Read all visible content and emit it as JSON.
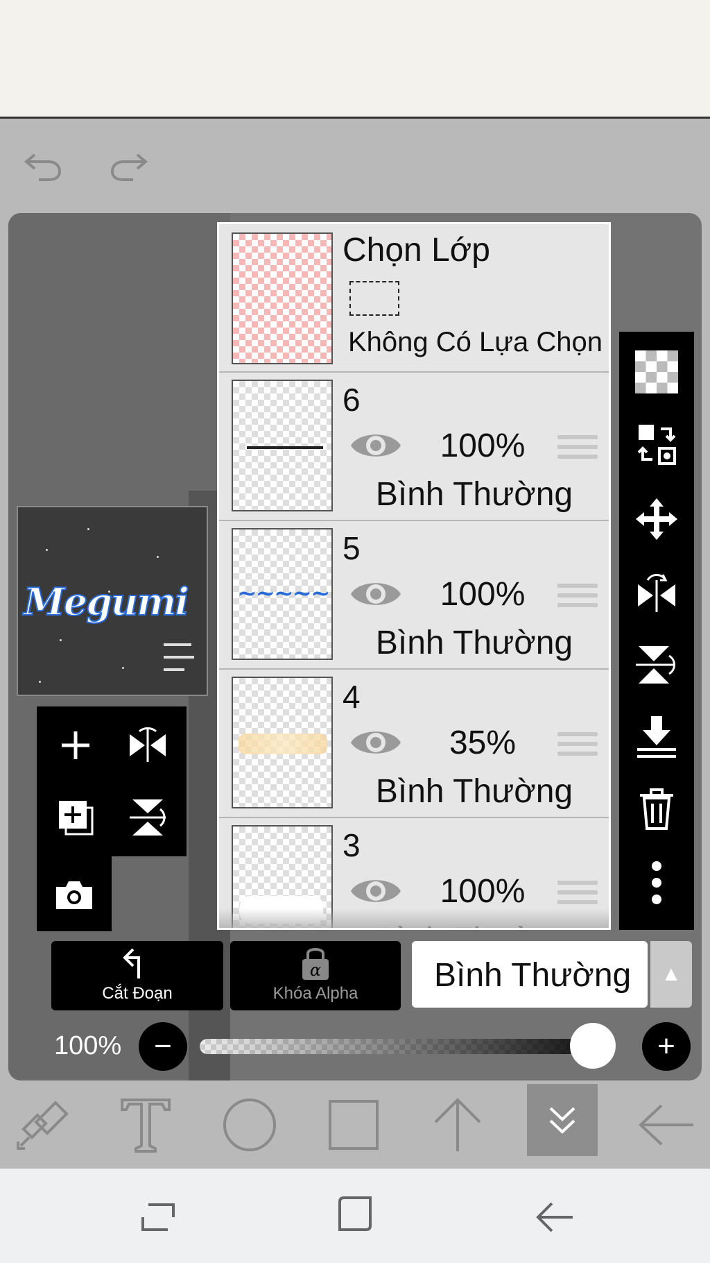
{
  "layer_panel": {
    "selection_layer": {
      "title": "Chọn Lớp",
      "subtitle": "Không Có Lựa Chọn"
    },
    "layers": [
      {
        "name": "6",
        "opacity": "100%",
        "blend": "Bình Thường"
      },
      {
        "name": "5",
        "opacity": "100%",
        "blend": "Bình Thường"
      },
      {
        "name": "4",
        "opacity": "35%",
        "blend": "Bình Thường"
      },
      {
        "name": "3",
        "opacity": "100%",
        "blend": "Bình Thường"
      }
    ]
  },
  "preview": {
    "title": "Megumi"
  },
  "controls": {
    "clipping_label": "Cắt Đoạn",
    "alpha_lock_label": "Khóa Alpha",
    "blend_mode": "Bình Thường",
    "opacity_label": "100%",
    "opacity_value": 1.0
  },
  "colors": {
    "accent": "#2a6bd8",
    "panel_bg": "#e6e6e6",
    "canvas_bg": "#737373"
  },
  "icons": {
    "toolbar": [
      "undo-icon",
      "redo-icon"
    ],
    "left_tools": [
      "add-layer-icon",
      "flip-horizontal-icon",
      "copy-layer-icon",
      "flip-vertical-icon",
      "camera-icon"
    ],
    "right_tools": [
      "transparent-icon",
      "swap-layer-icon",
      "move-icon",
      "flip-h-icon",
      "flip-v-icon",
      "merge-down-icon",
      "delete-icon",
      "more-icon"
    ],
    "bottom_tools": [
      "transform-icon",
      "text-icon",
      "ellipse-icon",
      "rectangle-icon",
      "arrow-up-icon",
      "collapse-icon",
      "back-icon"
    ],
    "system_nav": [
      "recent-apps-icon",
      "home-icon",
      "nav-back-icon"
    ]
  }
}
